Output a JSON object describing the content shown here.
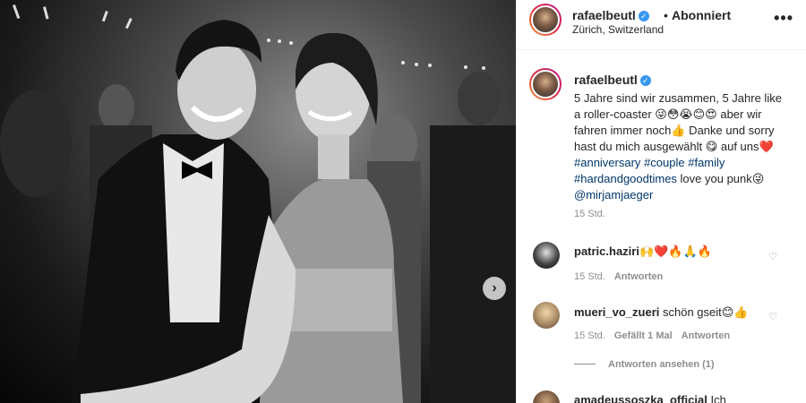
{
  "header": {
    "username": "rafaelbeutl",
    "separator": "•",
    "follow_status": "Abonniert",
    "location": "Zürich, Switzerland",
    "more": "•••"
  },
  "caption": {
    "username": "rafaelbeutl",
    "line1": "5 Jahre sind wir zusammen, 5 Jahre like a roller-coaster 😜😳😭😊😍",
    "line2": "aber wir fahren immer noch👍 Danke und sorry hast du mich ausgewählt 😋 auf uns❤️",
    "tag1": "#anniversary",
    "tag2": "#couple",
    "tag3": "#family",
    "tag4": "#hardandgoodtimes",
    "line3": "love you punk😜",
    "mention": "@mirjamjaeger",
    "time": "15 Std."
  },
  "comments": [
    {
      "username": "patric.haziri",
      "text": "🙌❤️🔥🙏🔥",
      "time": "15 Std.",
      "reply": "Antworten"
    },
    {
      "username": "mueri_vo_zueri",
      "text": "schön gseit😊👍",
      "time": "15 Std.",
      "likes": "Gefällt 1 Mal",
      "reply": "Antworten"
    },
    {
      "username": "amadeussoszka_official",
      "text": "Ich"
    }
  ],
  "view_replies": "Antworten ansehen (1)",
  "icons": {
    "verified": "verified-badge-icon",
    "heart": "heart-icon",
    "next": "chevron-right-icon"
  },
  "colors": {
    "verified": "#3897f0",
    "hashtag": "#00376b",
    "muted": "#8e8e8e"
  }
}
